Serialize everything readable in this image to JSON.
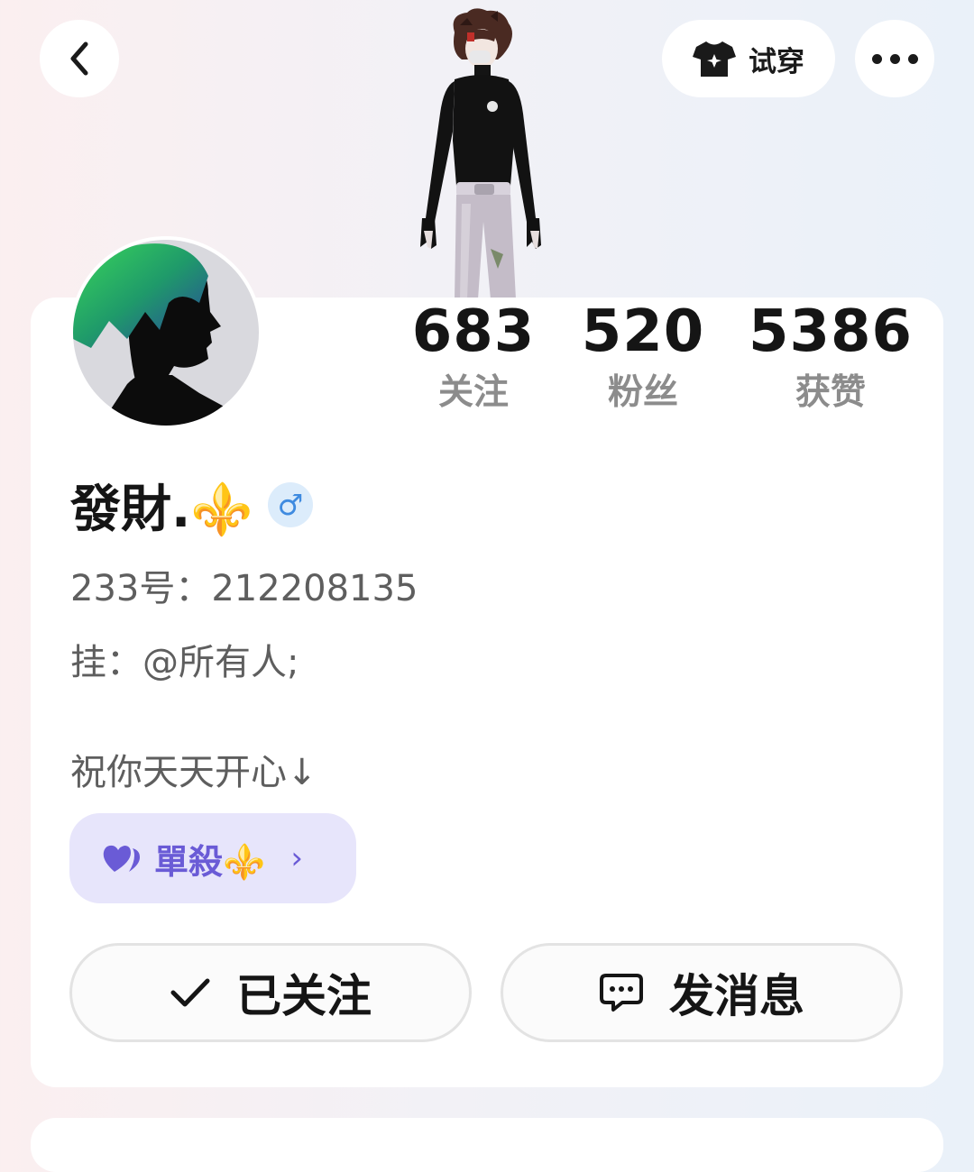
{
  "header": {
    "back_icon": "chevron-left-icon",
    "try_on_label": "试穿",
    "try_on_icon": "tshirt-icon",
    "more_icon": "more-dots-icon"
  },
  "profile": {
    "username": "發財.⚜️",
    "gender_symbol": "♂",
    "id_line": "233号：212208135",
    "bio_line1": "挂：@所有人;",
    "bio_line2": "祝你天天开心↓"
  },
  "stats": [
    {
      "value": "683",
      "label": "关注"
    },
    {
      "value": "520",
      "label": "粉丝"
    },
    {
      "value": "5386",
      "label": "获赞"
    }
  ],
  "group_tag": {
    "name": "單殺⚜️",
    "arrow": "›",
    "icon": "hearts-icon"
  },
  "actions": {
    "follow_label": "已关注",
    "message_label": "发消息"
  },
  "colors": {
    "accent_purple": "#6a5bd6",
    "tag_bg": "#e7e5fb",
    "gender_blue": "#3f8be0"
  }
}
